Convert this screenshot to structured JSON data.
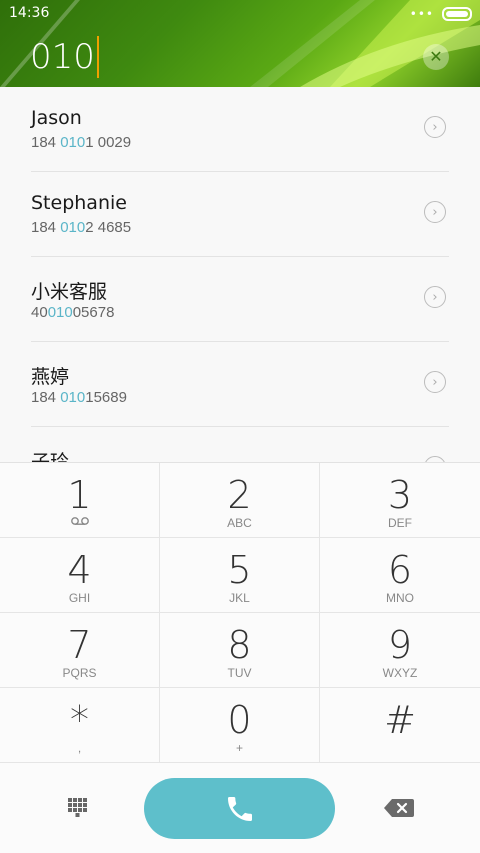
{
  "status": {
    "time": "14:36",
    "dots": "•••"
  },
  "dialer": {
    "input_value": "010"
  },
  "contacts": [
    {
      "name": "Jason",
      "number_pre": "184 ",
      "number_match": "010",
      "number_post": "1 0029"
    },
    {
      "name": "Stephanie",
      "number_pre": "184 ",
      "number_match": "010",
      "number_post": "2 4685"
    },
    {
      "name": "小米客服",
      "number_pre": "40",
      "number_match": "010",
      "number_post": "05678"
    },
    {
      "name": "燕婷",
      "number_pre": "184 ",
      "number_match": "010",
      "number_post": "15689"
    },
    {
      "name": "子玲",
      "number_pre": "",
      "number_match": "",
      "number_post": ""
    }
  ],
  "keypad": [
    {
      "digit": "1",
      "sub": ""
    },
    {
      "digit": "2",
      "sub": "ABC"
    },
    {
      "digit": "3",
      "sub": "DEF"
    },
    {
      "digit": "4",
      "sub": "GHI"
    },
    {
      "digit": "5",
      "sub": "JKL"
    },
    {
      "digit": "6",
      "sub": "MNO"
    },
    {
      "digit": "7",
      "sub": "PQRS"
    },
    {
      "digit": "8",
      "sub": "TUV"
    },
    {
      "digit": "9",
      "sub": "WXYZ"
    },
    {
      "digit": "*",
      "sub": ","
    },
    {
      "digit": "0",
      "sub": "+"
    },
    {
      "digit": "#",
      "sub": ""
    }
  ],
  "icons": {
    "voicemail": "voicemail-icon",
    "clear": "clear-icon",
    "dialpad": "dialpad-icon",
    "call": "phone-icon",
    "backspace": "backspace-icon"
  },
  "colors": {
    "accent": "#5ebfcb",
    "match": "#5ab5c8",
    "header": "#4a9a12"
  }
}
